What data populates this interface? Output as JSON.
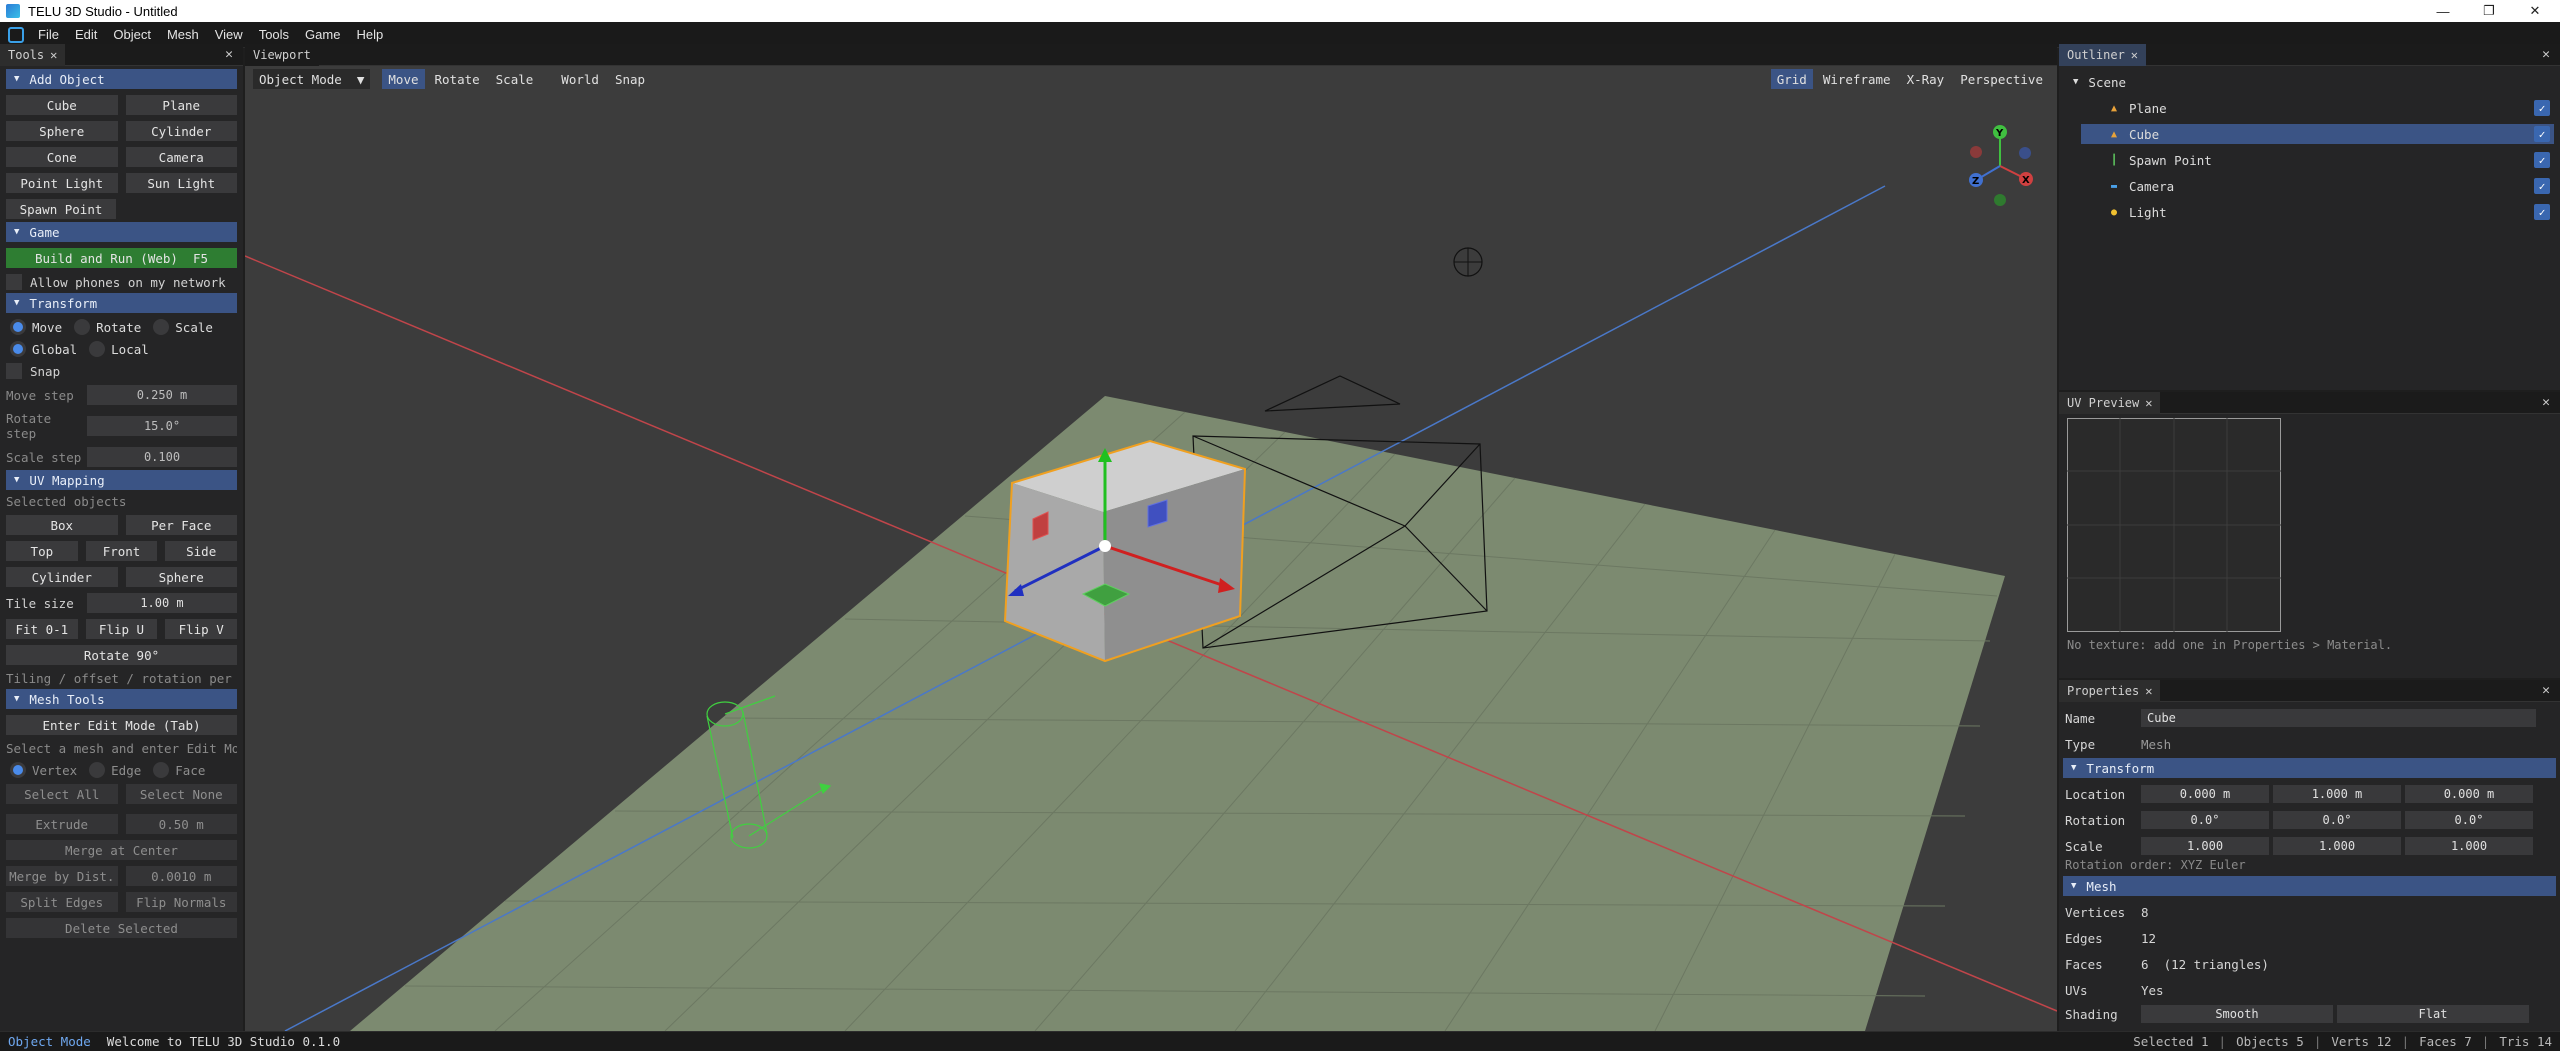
{
  "window": {
    "title": "TELU 3D Studio - Untitled"
  },
  "menubar": {
    "items": [
      "File",
      "Edit",
      "Object",
      "Mesh",
      "View",
      "Tools",
      "Game",
      "Help"
    ]
  },
  "tools": {
    "tab": "Tools",
    "add_object": {
      "header": "Add Object",
      "buttons": [
        "Cube",
        "Plane",
        "Sphere",
        "Cylinder",
        "Cone",
        "Camera",
        "Point Light",
        "Sun Light",
        "Spawn Point"
      ]
    },
    "game": {
      "header": "Game",
      "build_button": "Build and Run (Web)  F5",
      "allow_phones": "Allow phones on my network"
    },
    "transform": {
      "header": "Transform",
      "modes": [
        "Move",
        "Rotate",
        "Scale"
      ],
      "spaces": [
        "Global",
        "Local"
      ],
      "snap": "Snap",
      "move_step_label": "Move step",
      "move_step": "0.250 m",
      "rotate_step_label": "Rotate step",
      "rotate_step": "15.0°",
      "scale_step_label": "Scale step",
      "scale_step": "0.100"
    },
    "uv_mapping": {
      "header": "UV Mapping",
      "note": "Selected objects",
      "box": "Box",
      "per_face": "Per Face",
      "top": "Top",
      "front": "Front",
      "side": "Side",
      "cylinder": "Cylinder",
      "sphere": "Sphere",
      "tile_size_label": "Tile size",
      "tile_size": "1.00 m",
      "fit": "Fit 0-1",
      "flip_u": "Flip U",
      "flip_v": "Flip V",
      "rotate": "Rotate 90°",
      "footer": "Tiling / offset / rotation per mat"
    },
    "mesh_tools": {
      "header": "Mesh Tools",
      "edit_mode": "Enter Edit Mode (Tab)",
      "hint": "Select a mesh and enter Edit Mode",
      "select_modes": [
        "Vertex",
        "Edge",
        "Face"
      ],
      "select_all": "Select All",
      "select_none": "Select None",
      "extrude": "Extrude",
      "extrude_value": "0.50 m",
      "merge_center": "Merge at Center",
      "merge_dist": "Merge by Dist.",
      "merge_dist_value": "0.0010 m",
      "split_edges": "Split Edges",
      "flip_normals": "Flip Normals",
      "delete_selected": "Delete Selected"
    }
  },
  "viewport": {
    "tab": "Viewport",
    "mode": "Object Mode",
    "tools": [
      "Move",
      "Rotate",
      "Scale"
    ],
    "space_buttons": [
      "World",
      "Snap"
    ],
    "view_toggles": [
      "Grid",
      "Wireframe",
      "X-Ray",
      "Perspective"
    ],
    "gizmo_axes": [
      "Y",
      "X",
      "Z"
    ]
  },
  "outliner": {
    "tab": "Outliner",
    "root": "Scene",
    "items": [
      {
        "name": "Plane",
        "icon": "mesh-icon",
        "color": "#e8a23a"
      },
      {
        "name": "Cube",
        "icon": "mesh-icon",
        "color": "#e8a23a",
        "selected": true
      },
      {
        "name": "Spawn Point",
        "icon": "spawn-icon",
        "color": "#5cc05c"
      },
      {
        "name": "Camera",
        "icon": "camera-icon",
        "color": "#4aa0e8"
      },
      {
        "name": "Light",
        "icon": "light-icon",
        "color": "#f0c030"
      }
    ]
  },
  "uv_preview": {
    "tab": "UV Preview",
    "note": "No texture: add one in Properties > Material."
  },
  "properties": {
    "tab": "Properties",
    "name_label": "Name",
    "name": "Cube",
    "type_label": "Type",
    "type": "Mesh",
    "transform_header": "Transform",
    "location_label": "Location",
    "location": [
      "0.000 m",
      "1.000 m",
      "0.000 m"
    ],
    "rotation_label": "Rotation",
    "rotation": [
      "0.0°",
      "0.0°",
      "0.0°"
    ],
    "scale_label": "Scale",
    "scale": [
      "1.000",
      "1.000",
      "1.000"
    ],
    "rotation_order": "Rotation order: XYZ Euler",
    "mesh_header": "Mesh",
    "vertices_label": "Vertices",
    "vertices": "8",
    "edges_label": "Edges",
    "edges": "12",
    "faces_label": "Faces",
    "faces": "6  (12 triangles)",
    "uvs_label": "UVs",
    "uvs": "Yes",
    "shading_label": "Shading",
    "shading_smooth": "Smooth",
    "shading_flat": "Flat"
  },
  "statusbar": {
    "mode": "Object Mode",
    "message": "Welcome to TELU 3D Studio 0.1.0",
    "stats": [
      "Selected 1",
      "Objects 5",
      "Verts 12",
      "Faces 7",
      "Tris 14"
    ]
  },
  "colors": {
    "accent": "#3b5485",
    "build_green": "#2e7d32",
    "selection_outline": "#f0a020"
  }
}
